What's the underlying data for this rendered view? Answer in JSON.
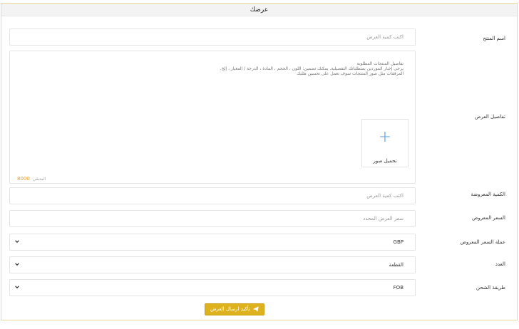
{
  "header": {
    "title": "عرضك"
  },
  "form": {
    "product_name": {
      "label": "اسم المنتج",
      "placeholder": "اكتب كمية العرض",
      "value": ""
    },
    "details": {
      "label": "تفاصيل العرض",
      "placeholder": "تفاصيل المنتجات المطلوبة\nيرجى إخبار الموردين بمتطلباتك التفصيلية. يمكنك تضمين: اللون ، الحجم ، المادة ، الدرجة / المعيار ، إلخ.\nالمرفقات مثل صور المنتجات سوف تعمل على تحسين طلبك",
      "upload_label": "تحميل صور",
      "remaining_label": "المتبقي",
      "remaining_count": "8000"
    },
    "quantity": {
      "label": "الكمية المعروضة",
      "placeholder": "اكتب كمية العرض",
      "value": ""
    },
    "price": {
      "label": "السعر المعروض",
      "placeholder": "سعر العرض المحدد",
      "value": ""
    },
    "currency": {
      "label": "عملة السعر المعروض",
      "value": "GBP"
    },
    "unit": {
      "label": "العدد",
      "value": "القطعة"
    },
    "shipping": {
      "label": "طريقة الشحن",
      "value": "FOB"
    },
    "submit_label": "تأكيد ارسال العرض"
  },
  "colors": {
    "accent": "#ddb21e",
    "border_frame": "#efd99a",
    "plus_icon": "#4d9be0",
    "remaining_count": "#e89b2c"
  }
}
